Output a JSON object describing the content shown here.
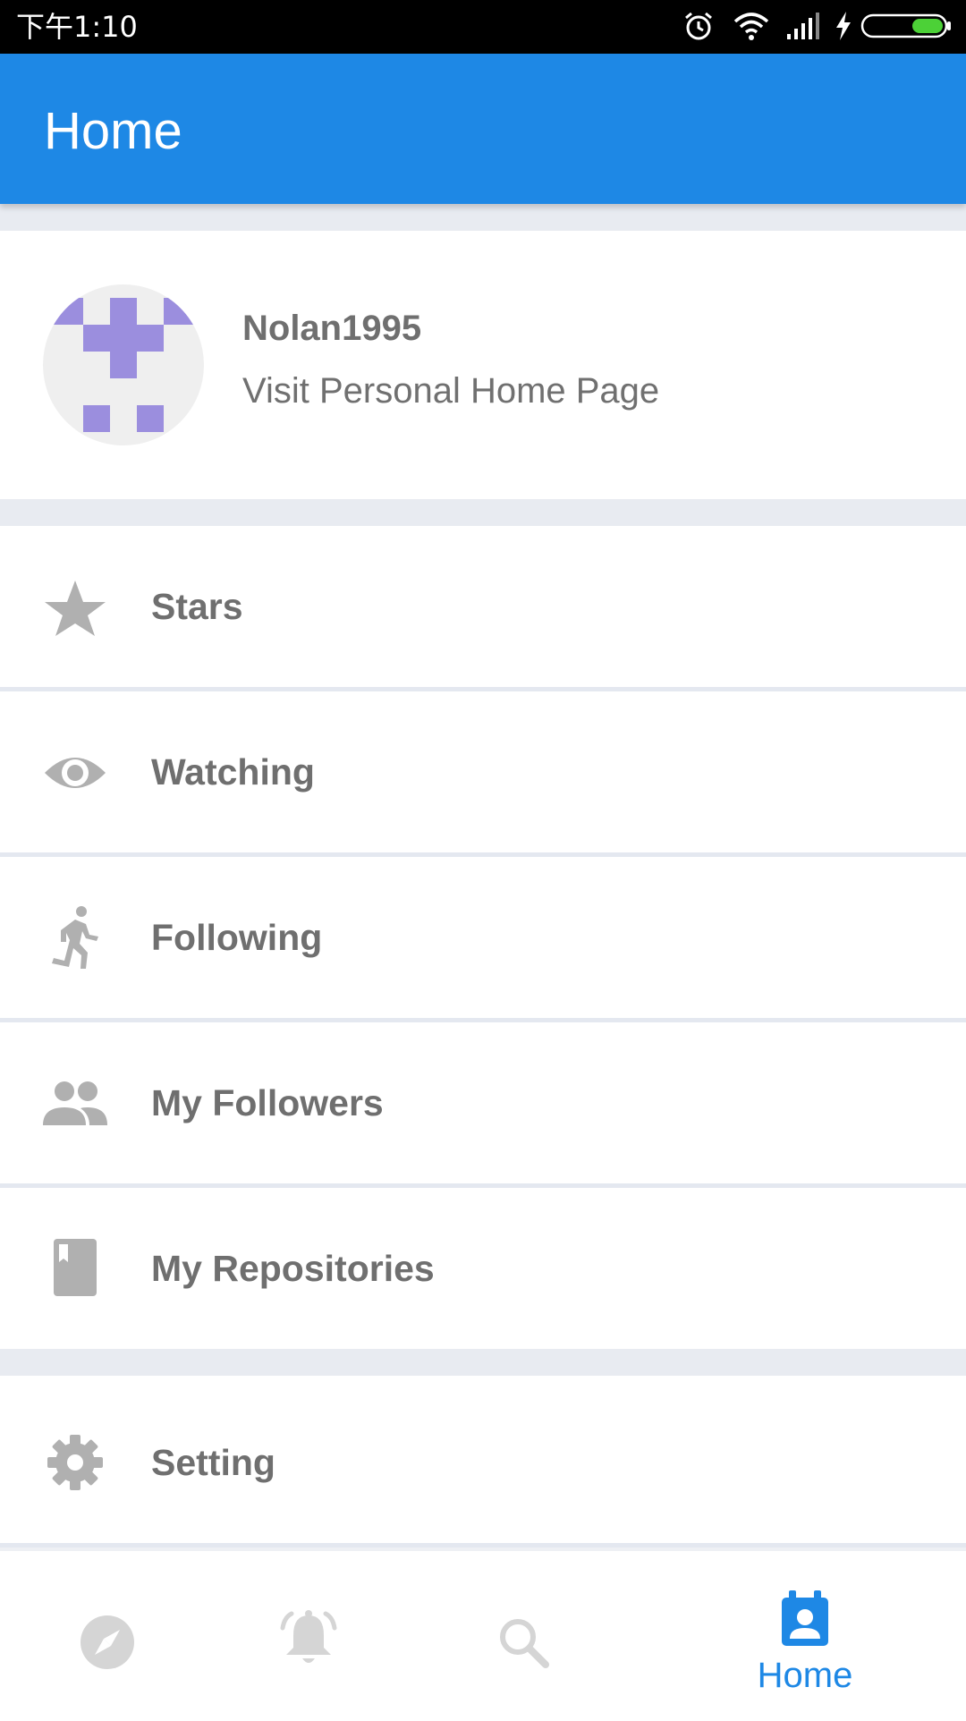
{
  "status_bar": {
    "time": "下午1:10"
  },
  "app_bar": {
    "title": "Home"
  },
  "profile": {
    "username": "Nolan1995",
    "link_text": "Visit Personal Home Page"
  },
  "menu": {
    "items": [
      {
        "label": "Stars",
        "icon": "star-icon"
      },
      {
        "label": "Watching",
        "icon": "eye-icon"
      },
      {
        "label": "Following",
        "icon": "running-person-icon"
      },
      {
        "label": "My Followers",
        "icon": "people-icon"
      },
      {
        "label": "My Repositories",
        "icon": "book-icon"
      }
    ],
    "setting": {
      "label": "Setting",
      "icon": "gear-icon"
    }
  },
  "bottom_nav": {
    "items": [
      {
        "name": "explore",
        "icon": "compass-icon"
      },
      {
        "name": "notifications",
        "icon": "bell-icon"
      },
      {
        "name": "search",
        "icon": "search-icon"
      },
      {
        "name": "home",
        "icon": "contact-calendar-icon",
        "label": "Home",
        "active": true
      }
    ]
  },
  "colors": {
    "primary": "#1e88e5",
    "text_gray": "#6f6f6f",
    "icon_gray": "#b0b0b0",
    "divider": "#e8ebf1",
    "avatar_purple": "#9b8ede",
    "battery_green": "#4cd137"
  }
}
